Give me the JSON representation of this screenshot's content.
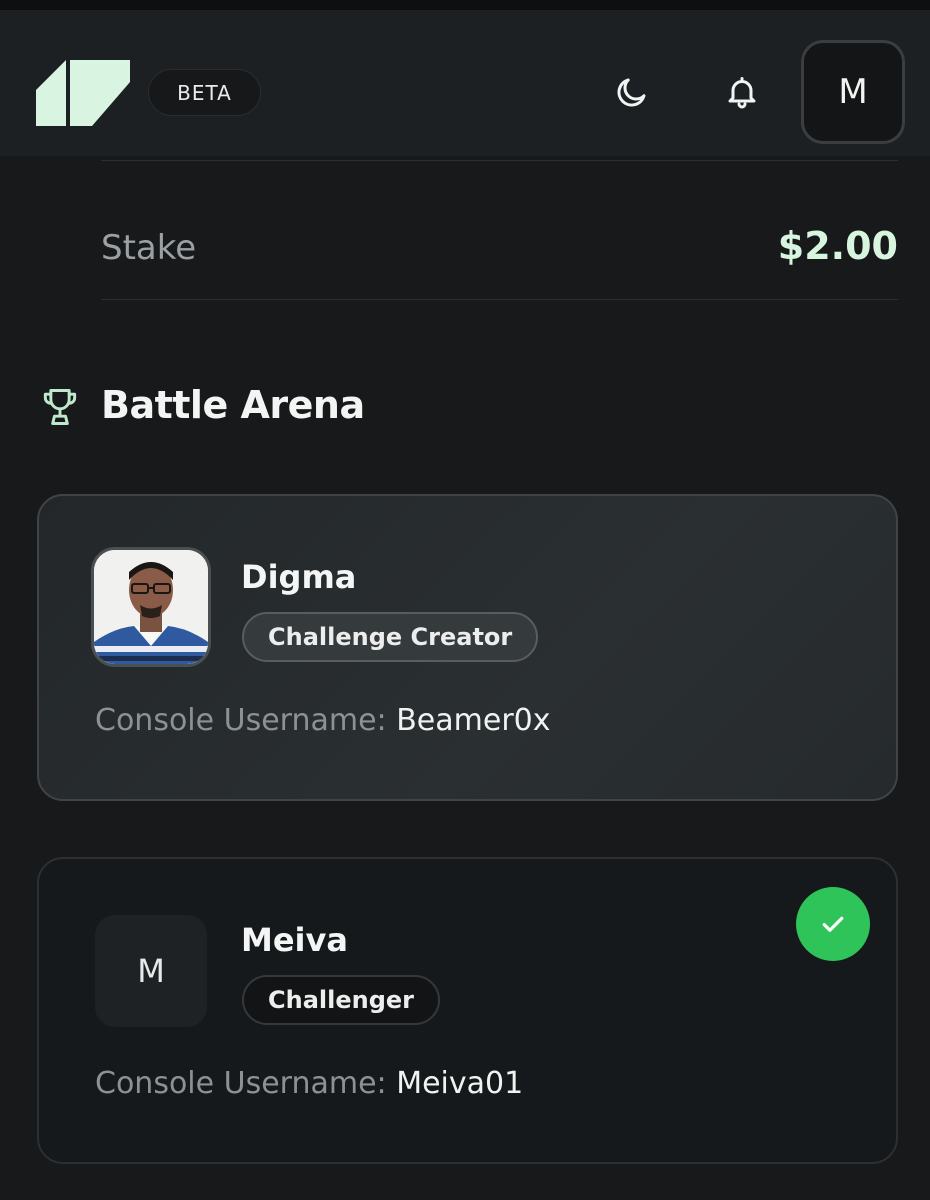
{
  "header": {
    "beta_label": "BETA",
    "avatar_initial": "M",
    "icons": [
      "logo-icon",
      "moon-icon",
      "bell-icon"
    ]
  },
  "stake": {
    "label": "Stake",
    "value": "$2.00"
  },
  "section": {
    "title": "Battle Arena",
    "icon": "trophy-icon"
  },
  "players": [
    {
      "name": "Digma",
      "role": "Challenge Creator",
      "console_label": "Console Username:",
      "console_username": "Beamer0x",
      "avatar": "photo"
    },
    {
      "name": "Meiva",
      "role": "Challenger",
      "console_label": "Console Username:",
      "console_username": "Meiva01",
      "avatar_initial": "M",
      "status_icon": "check-icon"
    }
  ],
  "colors": {
    "accent": "#d7f5df",
    "success": "#2fc45a",
    "background": "#17191b"
  }
}
